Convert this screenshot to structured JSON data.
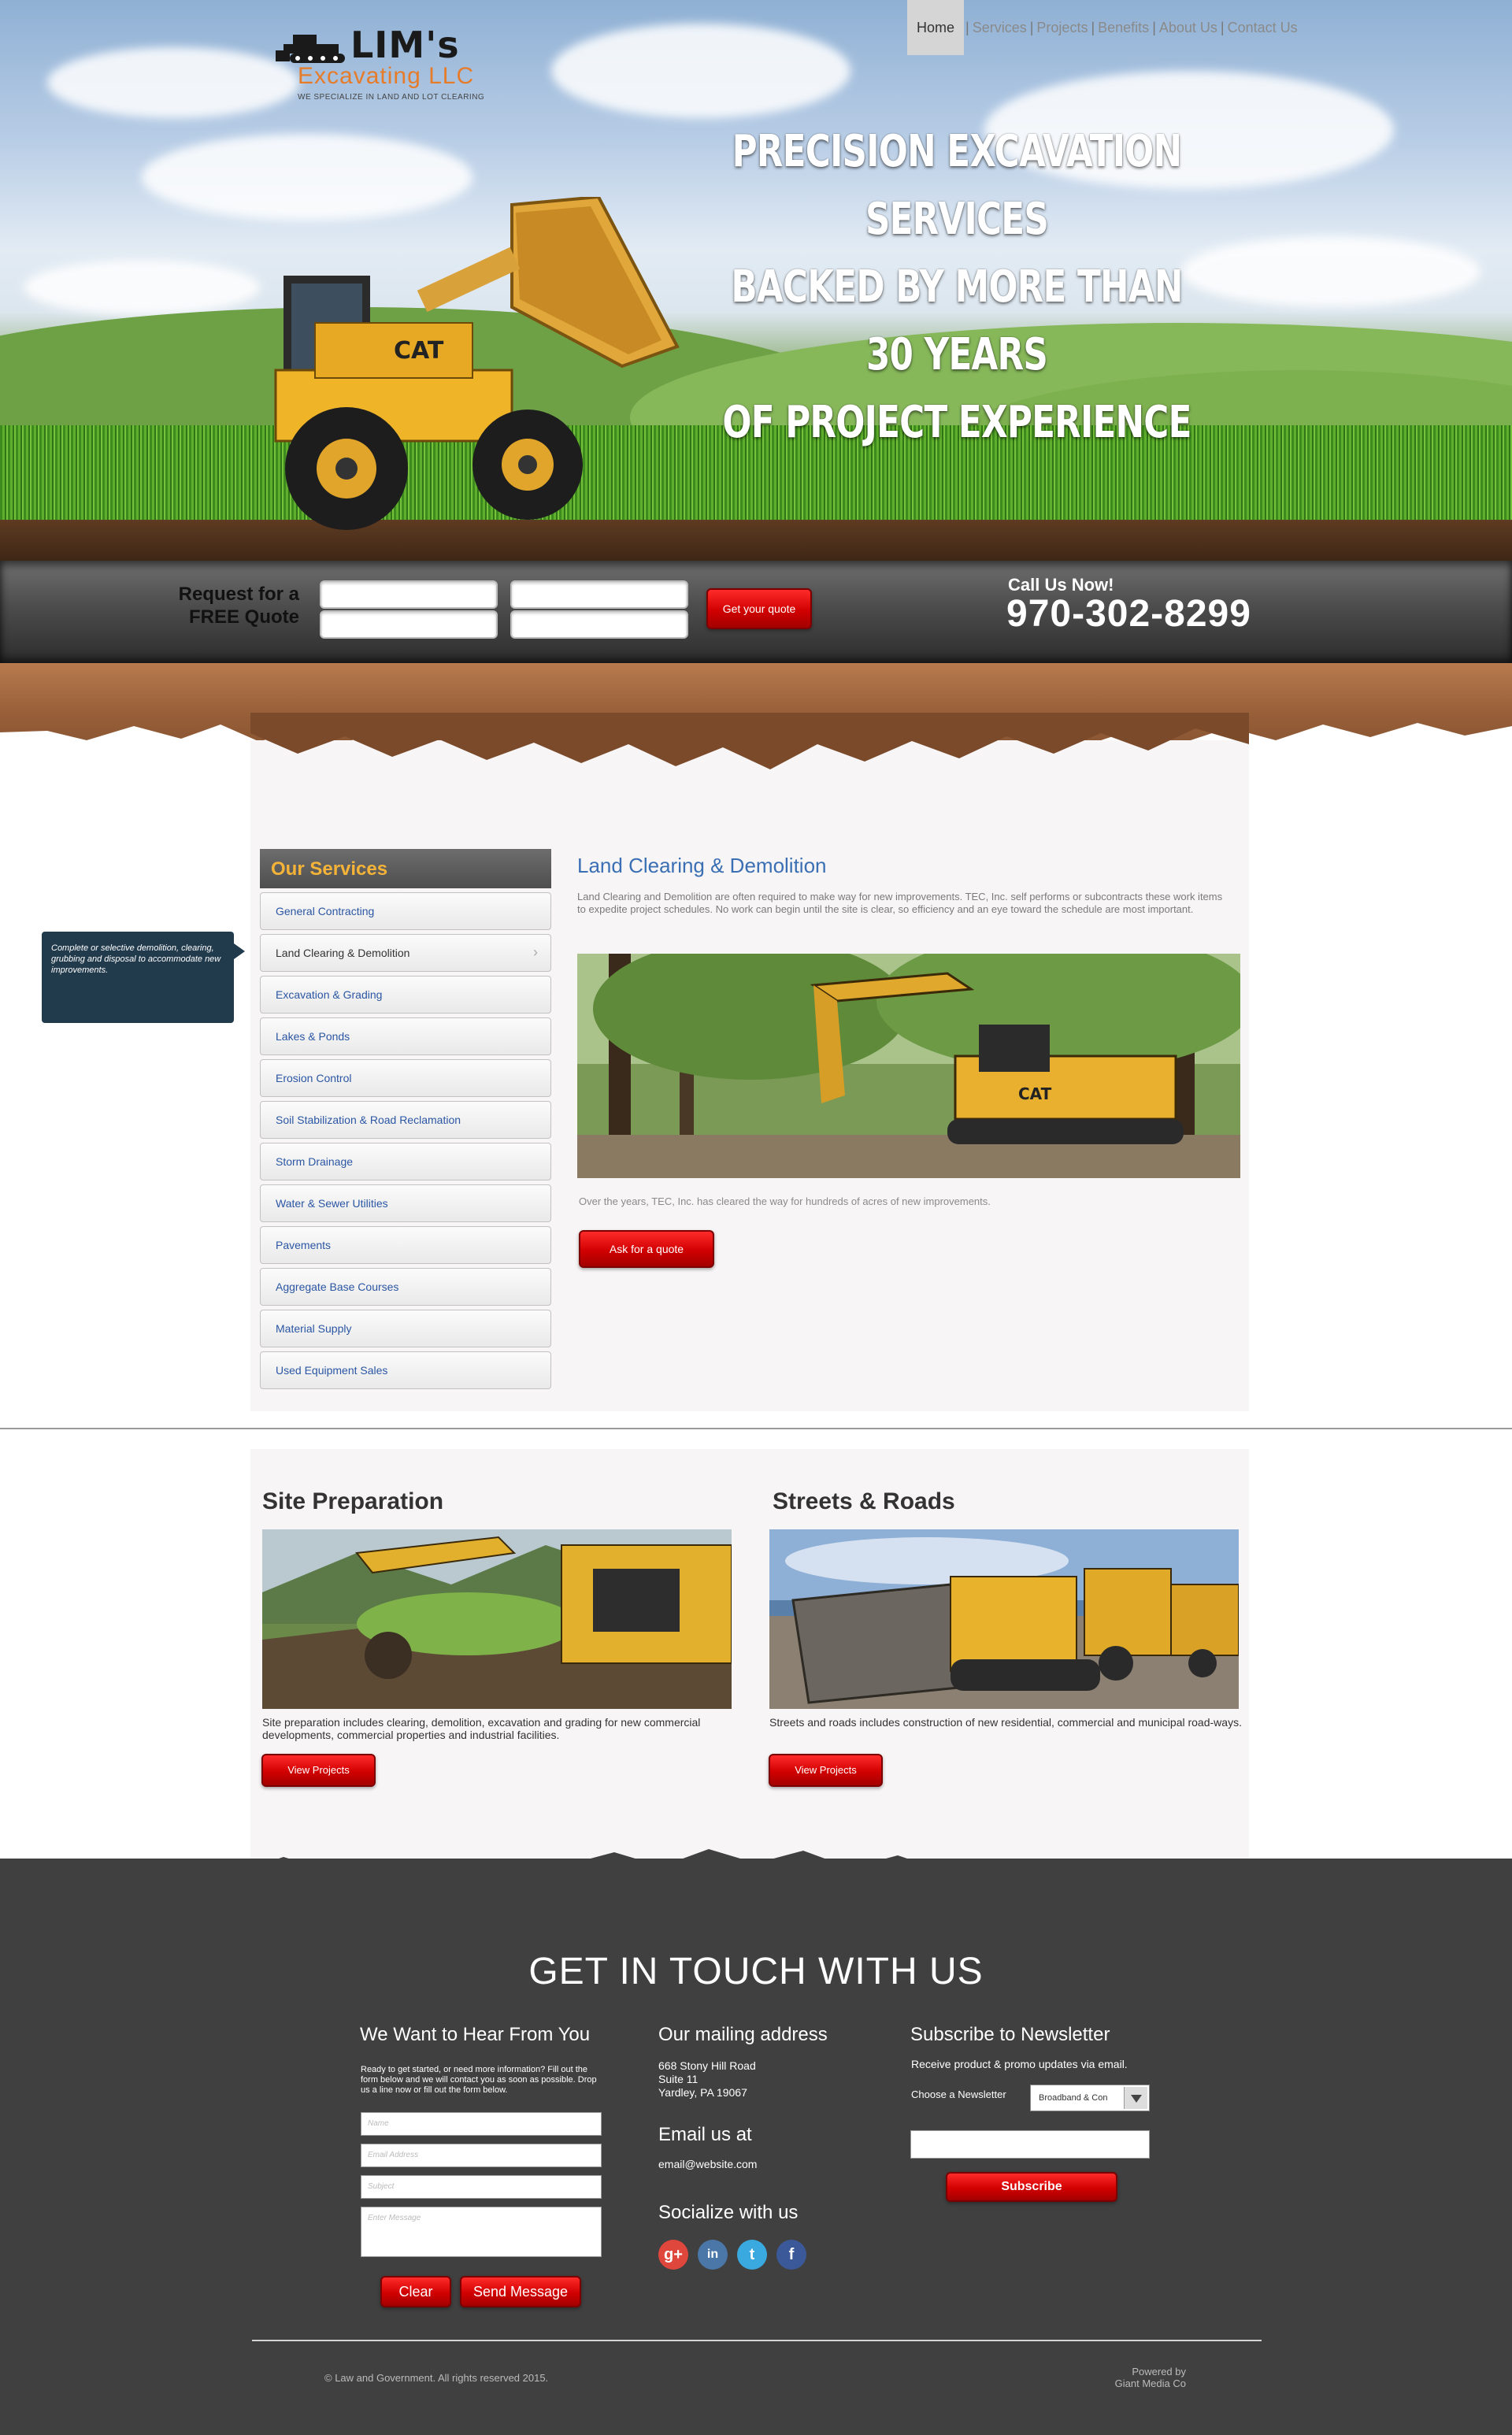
{
  "brand": {
    "name": "LIM's",
    "subtitle": "Excavating LLC",
    "tagline": "WE SPECIALIZE IN LAND AND LOT CLEARING"
  },
  "nav": {
    "items": [
      {
        "label": "Home",
        "active": true
      },
      {
        "label": "Services"
      },
      {
        "label": "Projects"
      },
      {
        "label": "Benefits"
      },
      {
        "label": "About Us"
      },
      {
        "label": "Contact Us"
      }
    ],
    "separator": "|"
  },
  "hero": {
    "headline_lines": [
      "PRECISION EXCAVATION SERVICES",
      "BACKED BY MORE THAN 30 YEARS",
      "OF PROJECT EXPERIENCE"
    ]
  },
  "quote_bar": {
    "label_line1": "Request for a",
    "label_line2": "FREE Quote",
    "button": "Get your quote",
    "call_label": "Call Us Now!",
    "phone": "970-302-8299"
  },
  "services": {
    "heading": "Our Services",
    "items": [
      "General Contracting",
      "Land Clearing & Demolition",
      "Excavation & Grading",
      "Lakes & Ponds",
      "Erosion Control",
      "Soil Stabilization & Road Reclamation",
      "Storm Drainage",
      "Water & Sewer Utilities",
      "Pavements",
      "Aggregate Base Courses",
      "Material Supply",
      "Used Equipment Sales"
    ],
    "active_index": 1,
    "tooltip": "Complete or selective demolition, clearing, grubbing and disposal to accommodate new improvements.",
    "detail": {
      "title": "Land Clearing & Demolition",
      "text": "Land Clearing and Demolition are often required to make way for new improvements.  TEC, Inc. self performs or subcontracts these work items to expedite project schedules.  No work can begin until the site is clear, so efficiency and an eye toward the schedule are most important.",
      "caption": "Over the years, TEC, Inc. has cleared the way for hundreds of acres of new improvements.",
      "button": "Ask for a quote"
    }
  },
  "projects": [
    {
      "title": "Site Preparation",
      "text": "Site preparation includes clearing, demolition, excavation and grading for new commercial developments, commercial properties and industrial facilities.",
      "button": "View Projects"
    },
    {
      "title": "Streets & Roads",
      "text": "Streets and roads includes construction of new residential, commercial and municipal road-ways.",
      "button": "View Projects"
    }
  ],
  "contact": {
    "title": "GET IN TOUCH WITH US",
    "form": {
      "title": "We Want to Hear From You",
      "intro": "Ready to get started, or need more information? Fill out the form below and we will contact you as soon as possible. Drop us a line now or fill out the form below.",
      "name_placeholder": "Name",
      "email_placeholder": "Email Address",
      "subject_placeholder": "Subject",
      "message_placeholder": "Enter Message",
      "clear": "Clear",
      "send": "Send Message"
    },
    "mailing": {
      "title": "Our mailing address",
      "lines": [
        "668 Stony Hill Road",
        "Suite 11",
        "Yardley, PA 19067"
      ]
    },
    "email": {
      "title": "Email us at",
      "address": "email@website.com"
    },
    "social": {
      "title": "Socialize with us",
      "icons": [
        "google-plus-icon",
        "linkedin-icon",
        "twitter-icon",
        "facebook-icon"
      ]
    },
    "newsletter": {
      "title": "Subscribe to Newsletter",
      "text": "Receive product & promo updates via email.",
      "choose_label": "Choose a Newsletter",
      "selected": "Broadband & Con",
      "button": "Subscribe"
    }
  },
  "footer": {
    "copyright": "© Law and Government. All rights reserved 2015.",
    "powered_line1": "Powered by",
    "powered_line2": "Giant Media Co"
  },
  "colors": {
    "accent_red": "#d10000",
    "link_blue": "#2b56a4",
    "title_blue": "#3a6fb4",
    "services_gold": "#f5b338",
    "footer_bg": "#404040",
    "tooltip_bg": "#213a4c"
  }
}
